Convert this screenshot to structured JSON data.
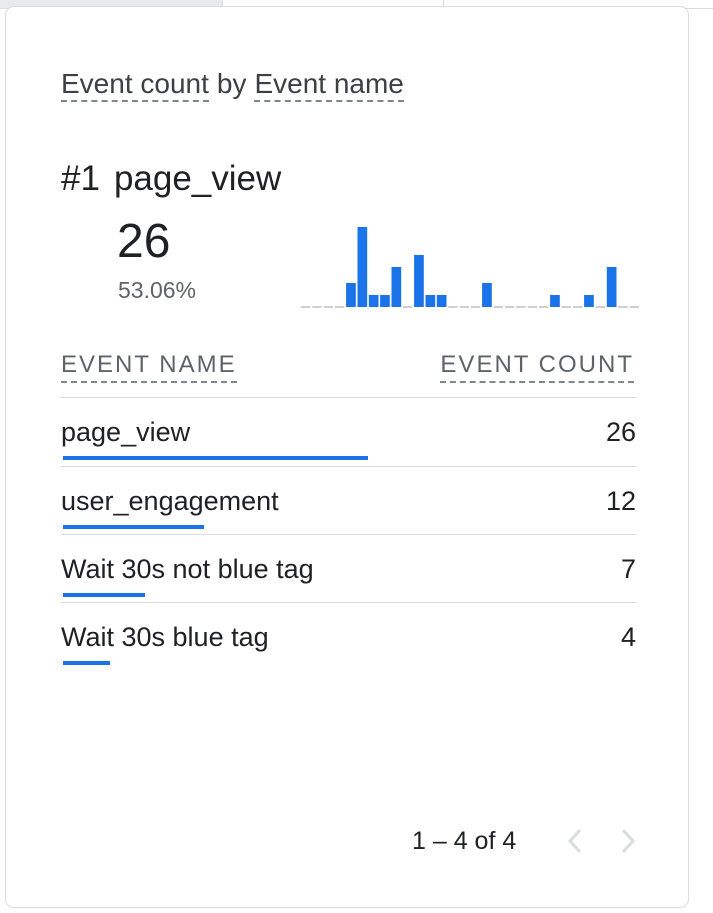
{
  "card": {
    "title_metric": "Event count",
    "title_by": "by",
    "title_dimension": "Event name",
    "top": {
      "rank": "#1",
      "name": "page_view",
      "value": "26",
      "percent": "53.06%"
    },
    "sparkline": {
      "values": [
        0,
        0,
        0,
        0,
        6,
        20,
        3,
        3,
        10,
        0,
        13,
        3,
        3,
        0,
        0,
        0,
        6,
        0,
        0,
        0,
        0,
        0,
        3,
        0,
        0,
        3,
        0,
        10,
        0,
        0
      ],
      "color": "#1a73e8"
    },
    "table": {
      "col_name": "EVENT NAME",
      "col_count": "EVENT COUNT",
      "rows": [
        {
          "name": "page_view",
          "count": "26",
          "share": 0.53
        },
        {
          "name": "user_engagement",
          "count": "12",
          "share": 0.245
        },
        {
          "name": "Wait 30s not blue tag",
          "count": "7",
          "share": 0.143
        },
        {
          "name": "Wait 30s blue tag",
          "count": "4",
          "share": 0.082
        }
      ]
    },
    "pagination": {
      "label": "1 – 4 of 4",
      "prev_icon": "chevron-left-icon",
      "next_icon": "chevron-right-icon"
    }
  },
  "colors": {
    "accent": "#1a73e8",
    "divider": "#dadce0",
    "muted_text": "#5f6368"
  }
}
